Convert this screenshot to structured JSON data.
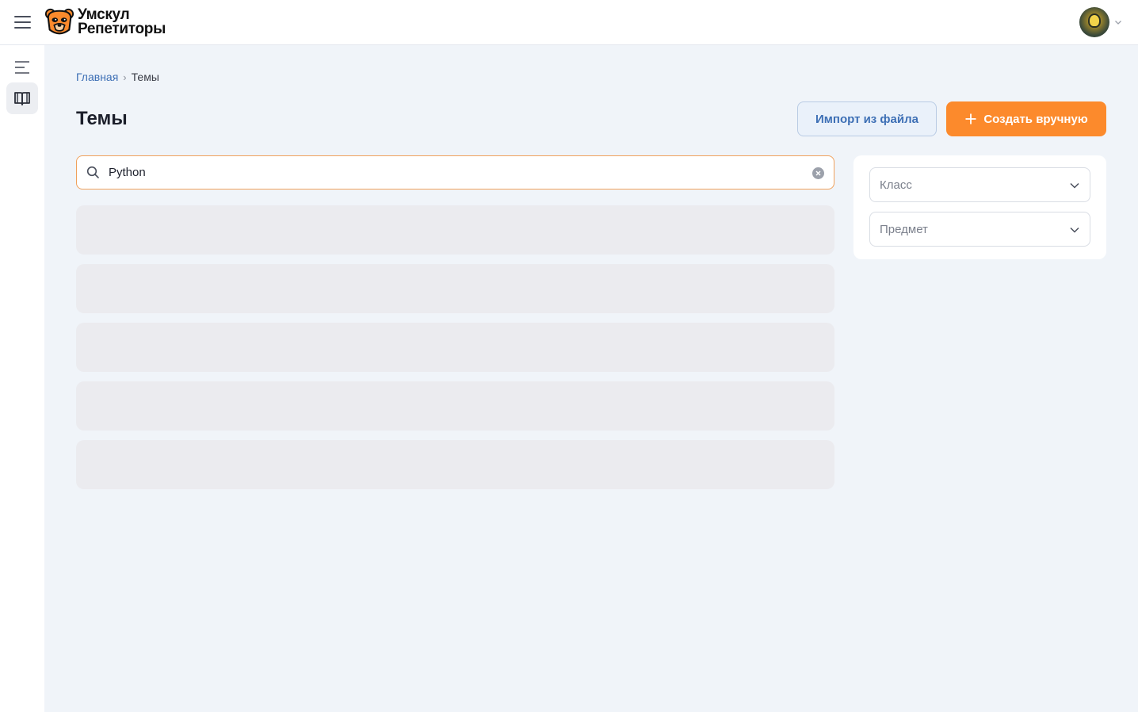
{
  "header": {
    "logo_line1": "Умскул",
    "logo_line2": "Репетиторы"
  },
  "breadcrumb": {
    "home": "Главная",
    "separator": "›",
    "current": "Темы"
  },
  "page": {
    "title": "Темы"
  },
  "actions": {
    "import_label": "Импорт из файла",
    "create_label": "Создать вручную"
  },
  "search": {
    "value": "Python"
  },
  "filters": {
    "grade_placeholder": "Класс",
    "subject_placeholder": "Предмет"
  },
  "colors": {
    "accent": "#fc8a2c",
    "link": "#3d6fb5",
    "background": "#f0f4f9"
  },
  "icons": {
    "menu": "hamburger-icon",
    "rail_collapse": "list-collapse-icon",
    "rail_topics": "book-open-icon",
    "search": "search-icon",
    "clear": "clear-icon",
    "chevron": "chevron-down-icon",
    "plus": "plus-icon"
  }
}
